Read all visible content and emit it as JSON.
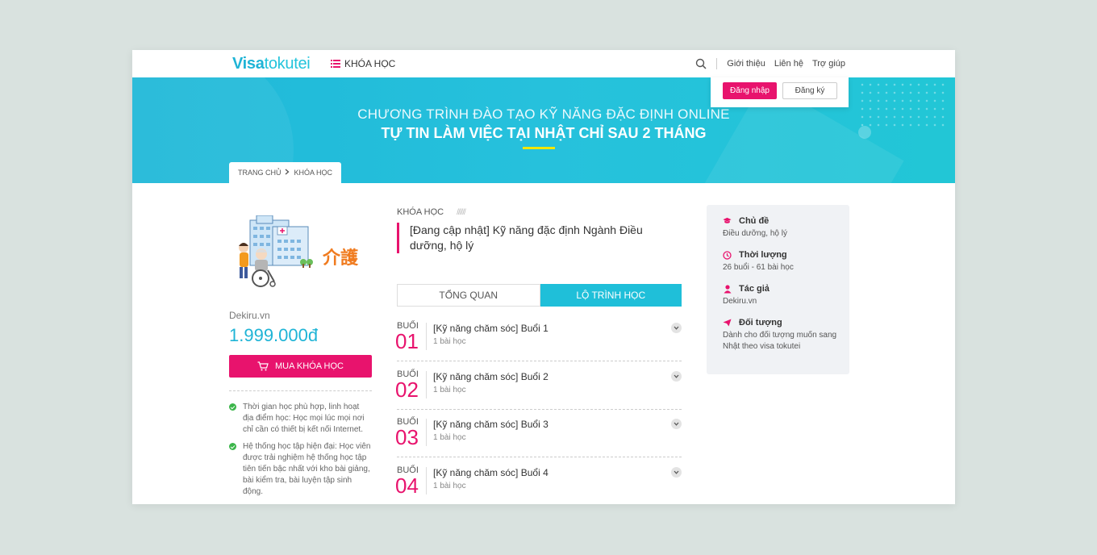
{
  "header": {
    "logo_part1": "Visa",
    "logo_part2": "tokutei",
    "courses_menu": "KHÓA HỌC",
    "nav_links": [
      "Giới thiệu",
      "Liên hệ",
      "Trợ giúp"
    ]
  },
  "auth": {
    "login": "Đăng nhập",
    "register": "Đăng ký"
  },
  "banner": {
    "line1": "CHƯƠNG TRÌNH ĐÀO TẠO KỸ NĂNG ĐẶC ĐỊNH ONLINE",
    "line2": "TỰ TIN LÀM VIỆC TẠI NHẬT CHỈ SAU 2 THÁNG"
  },
  "breadcrumb": {
    "home": "TRANG CHỦ",
    "current": "KHÓA HỌC"
  },
  "course": {
    "image_text": "介護",
    "provider": "Dekiru.vn",
    "price": "1.999.000đ",
    "buy_label": "MUA KHÓA HỌC",
    "benefits": [
      "Thời gian học phù hợp, linh hoạt địa điểm học: Học mọi lúc mọi nơi chỉ cần có thiết bị kết nối Internet.",
      "Hệ thống học tập hiện đại: Học viên được trải nghiệm hệ thống học tập tiên tiến bậc nhất với kho bài giảng, bài kiểm tra, bài luyện tập sinh động."
    ],
    "section_label": "KHÓA HỌC",
    "section_hatch": "//////",
    "title": "[Đang cập nhật] Kỹ năng đặc định Ngành Điều dưỡng, hộ lý"
  },
  "tabs": {
    "overview": "TỔNG QUAN",
    "curriculum": "LỘ TRÌNH HỌC"
  },
  "lessons": [
    {
      "label": "BUỔI",
      "num": "01",
      "title": "[Kỹ năng chăm sóc] Buổi 1",
      "count": "1 bài học"
    },
    {
      "label": "BUỔI",
      "num": "02",
      "title": "[Kỹ năng chăm sóc] Buổi 2",
      "count": "1 bài học"
    },
    {
      "label": "BUỔI",
      "num": "03",
      "title": "[Kỹ năng chăm sóc] Buổi 3",
      "count": "1 bài học"
    },
    {
      "label": "BUỔI",
      "num": "04",
      "title": "[Kỹ năng chăm sóc] Buổi 4",
      "count": "1 bài học"
    }
  ],
  "info": {
    "topic_label": "Chủ đề",
    "topic_value": "Điều dưỡng, hộ lý",
    "duration_label": "Thời lượng",
    "duration_value": "26 buổi - 61 bài học",
    "author_label": "Tác giả",
    "author_value": "Dekiru.vn",
    "audience_label": "Đối tượng",
    "audience_value": "Dành cho đối tượng muốn sang Nhật theo visa tokutei"
  },
  "colors": {
    "brand_pink": "#e8136d",
    "brand_cyan": "#1fb4d6",
    "banner_cyan": "#26c1dc",
    "check_green": "#3bb54a"
  },
  "icons": [
    "list-icon",
    "search-icon",
    "chevron-right-icon",
    "cart-icon",
    "check-icon",
    "chevron-down-icon",
    "graduation-cap-icon",
    "clock-icon",
    "user-icon",
    "paper-plane-icon"
  ]
}
